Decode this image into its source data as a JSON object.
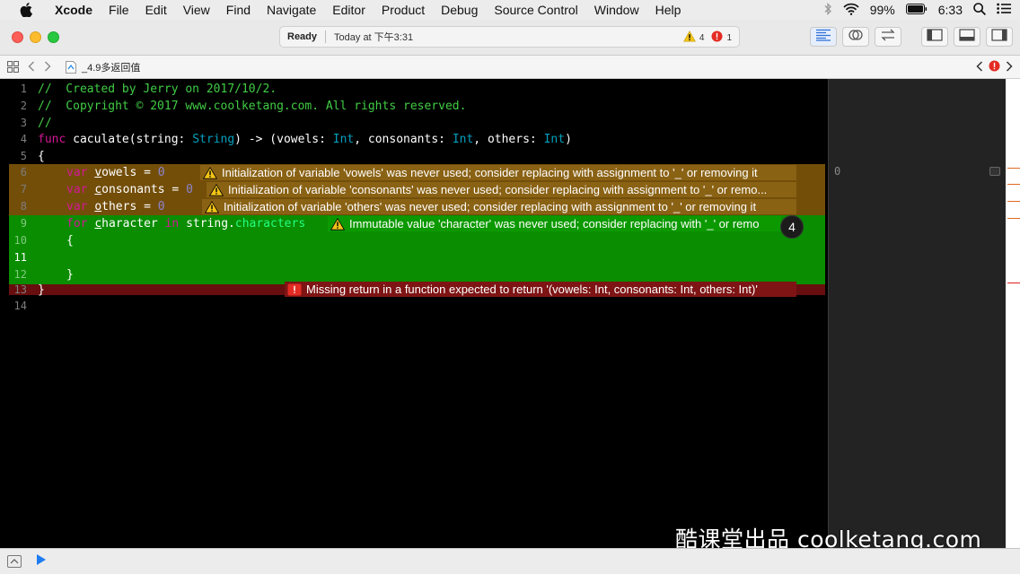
{
  "menubar": {
    "items": [
      "Xcode",
      "File",
      "Edit",
      "View",
      "Find",
      "Navigate",
      "Editor",
      "Product",
      "Debug",
      "Source Control",
      "Window",
      "Help"
    ],
    "battery": "99%",
    "clock": "6:33"
  },
  "toolbar": {
    "status": "Ready",
    "time": "Today at 下午3:31",
    "warning_count": "4",
    "error_count": "1"
  },
  "jumpbar": {
    "file_name": "_4.9多返回值"
  },
  "editor": {
    "line_numbers": [
      "1",
      "2",
      "3",
      "4",
      "5",
      "6",
      "7",
      "8",
      "9",
      "10",
      "11",
      "12",
      "13",
      "14"
    ],
    "line1": "//  Created by Jerry on 2017/10/2.",
    "line2": "//  Copyright © 2017 www.coolketang.com. All rights reserved.",
    "line3": "//",
    "line4": {
      "kw": "func",
      "name": " caculate(string: ",
      "type1": "String",
      "arrow": ") -> (vowels: ",
      "type2": "Int",
      "mid1": ", consonants: ",
      "type3": "Int",
      "mid2": ", others: ",
      "type4": "Int",
      "end": ")"
    },
    "line5": "{",
    "line6": {
      "kw": "var",
      "var_first": "v",
      "var_rest": "owels",
      "eq": " = ",
      "num": "0"
    },
    "line7": {
      "kw": "var",
      "var_first": "c",
      "var_rest": "onsonants",
      "eq": " = ",
      "num": "0"
    },
    "line8": {
      "kw": "var",
      "var_first": "o",
      "var_rest": "thers",
      "eq": " = ",
      "num": "0"
    },
    "line9": {
      "kw": "for",
      "var_first": "c",
      "var_rest": "haracter",
      "kw_in": " in ",
      "obj": "string.",
      "prop": "characters"
    },
    "line10": "{",
    "line12": "}",
    "line13": "}"
  },
  "issues": {
    "w6": "Initialization of variable 'vowels' was never used; consider replacing with assignment to '_' or removing it",
    "w7": "Initialization of variable 'consonants' was never used; consider replacing with assignment to '_' or remo...",
    "w8": "Initialization of variable 'others' was never used; consider replacing with assignment to '_' or removing it",
    "w9": "Immutable value 'character' was never used; consider replacing with '_' or remo",
    "e13": "Missing return in a function expected to return '(vowels: Int, consonants: Int, others: Int)'"
  },
  "badge": "4",
  "results": {
    "value": "0"
  },
  "watermark": "酷课堂出品 coolketang.com",
  "colors": {
    "warning": "#8a6214",
    "error": "#7e1414",
    "highlight": "#0a8d00"
  }
}
